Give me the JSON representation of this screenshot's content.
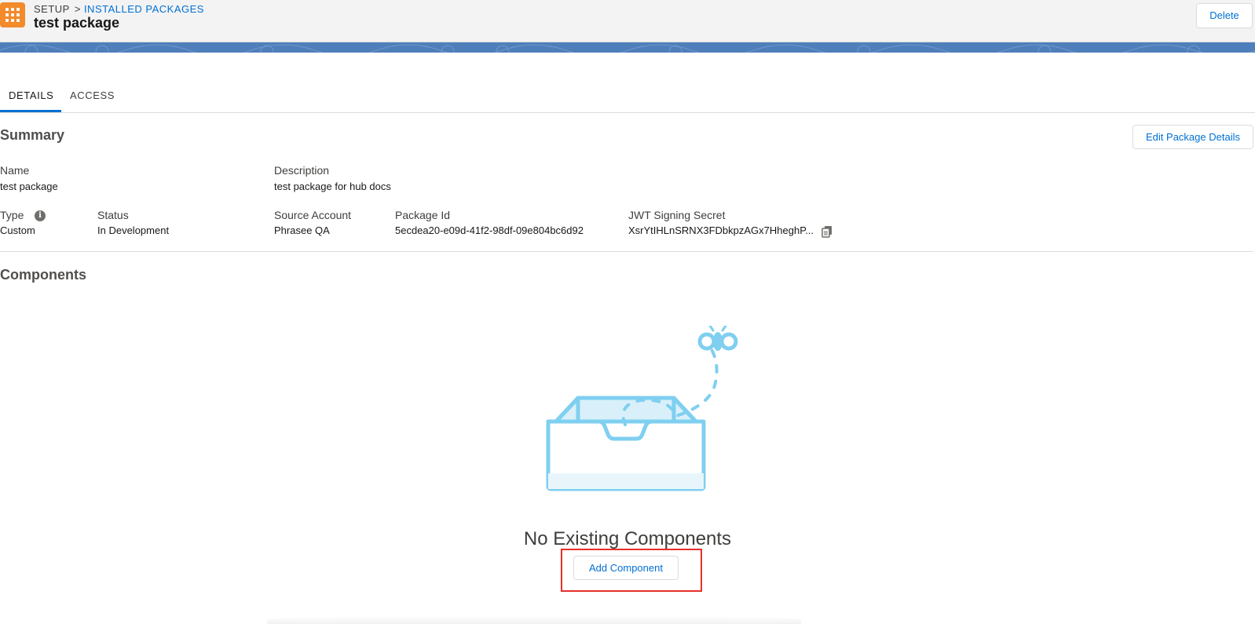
{
  "header": {
    "breadcrumb_root": "SETUP",
    "breadcrumb_separator": ">",
    "breadcrumb_link": "INSTALLED PACKAGES",
    "title": "test package",
    "delete_label": "Delete",
    "app_icon": "app-launcher-grid-icon"
  },
  "tabs": [
    {
      "label": "DETAILS",
      "active": true
    },
    {
      "label": "ACCESS",
      "active": false
    }
  ],
  "summary": {
    "title": "Summary",
    "edit_label": "Edit Package Details",
    "fields": {
      "name": {
        "label": "Name",
        "value": "test package"
      },
      "description": {
        "label": "Description",
        "value": "test package for hub docs"
      },
      "type": {
        "label": "Type",
        "value": "Custom"
      },
      "status": {
        "label": "Status",
        "value": "In Development"
      },
      "source_account": {
        "label": "Source Account",
        "value": "Phrasee QA"
      },
      "package_id": {
        "label": "Package Id",
        "value": "5ecdea20-e09d-41f2-98df-09e804bc6d92"
      },
      "jwt_secret": {
        "label": "JWT Signing Secret",
        "value": "XsrYtIHLnSRNX3FDbkpzAGx7HheghP..."
      }
    }
  },
  "components": {
    "title": "Components",
    "empty_title": "No Existing Components",
    "add_label": "Add Component"
  },
  "colors": {
    "accent": "#0070d2",
    "app_icon": "#f38a2b",
    "banner": "#4f7fbb",
    "highlight": "#e4302a",
    "illustration": "#7fcff0"
  }
}
